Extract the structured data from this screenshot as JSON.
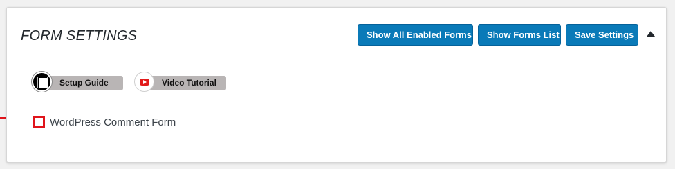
{
  "header": {
    "title": "FORM SETTINGS",
    "buttons": {
      "show_all_enabled_forms": "Show All Enabled Forms",
      "show_forms_list": "Show Forms List",
      "save_settings": "Save Settings"
    }
  },
  "help_links": {
    "setup_guide": "Setup Guide",
    "video_tutorial": "Video Tutorial"
  },
  "forms": [
    {
      "label": "WordPress Comment Form",
      "checked": false
    }
  ],
  "colors": {
    "primary_button": "#0a7ab8",
    "highlight": "#e0141b",
    "pill_background": "#b9b5b5"
  }
}
